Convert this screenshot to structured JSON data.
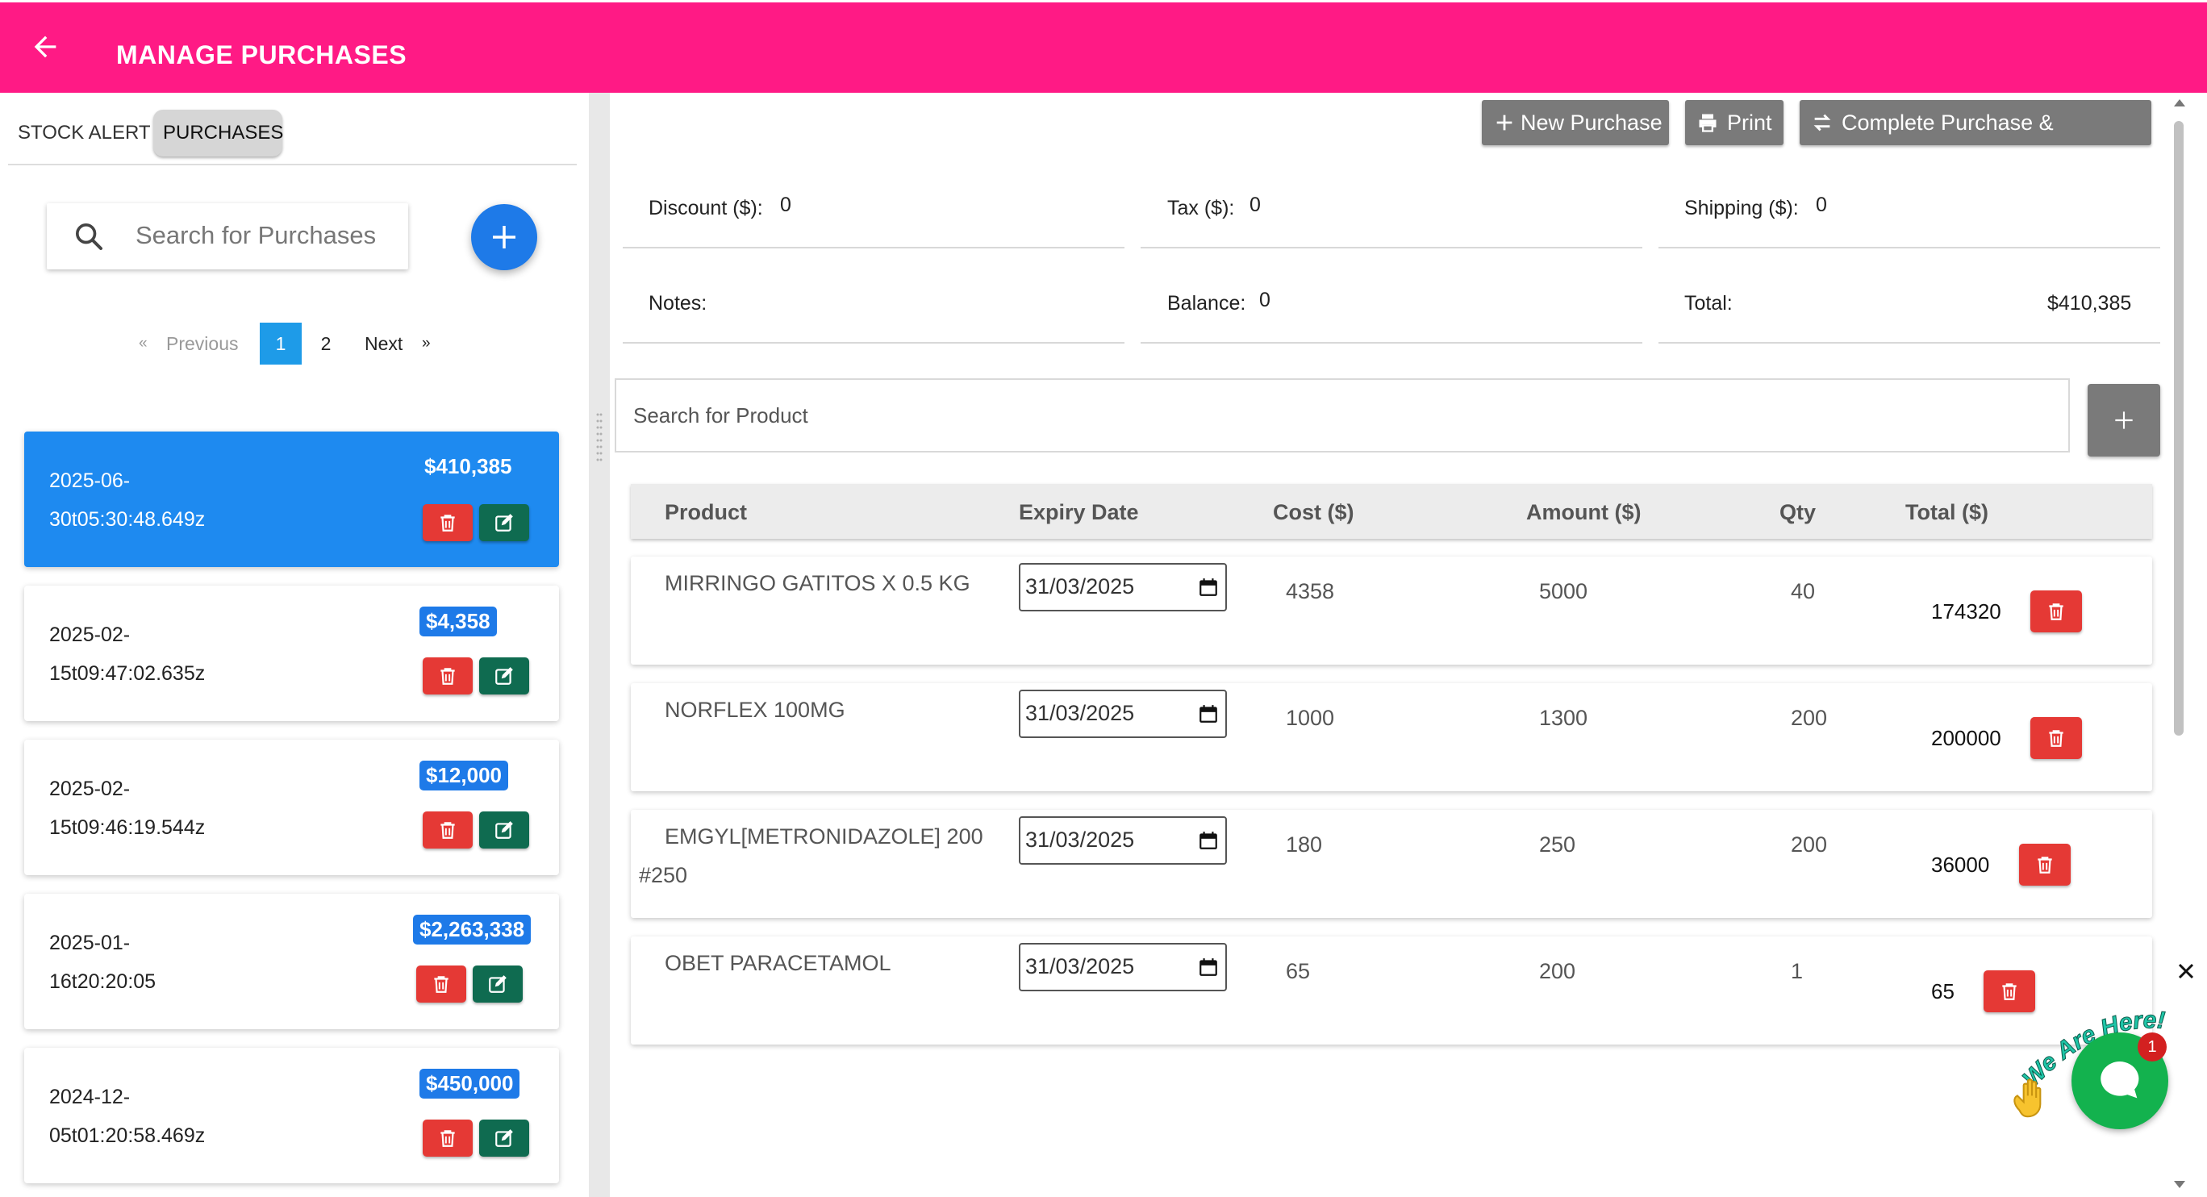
{
  "header": {
    "title": "MANAGE PURCHASES"
  },
  "tabs": [
    {
      "label": "STOCK ALERT"
    },
    {
      "label": "PURCHASES"
    }
  ],
  "search": {
    "placeholder": "Search for Purchases"
  },
  "pagination": {
    "previous": "Previous",
    "pages": [
      "1",
      "2"
    ],
    "current": "1",
    "next": "Next",
    "prev_arrow": "«",
    "next_arrow": "»"
  },
  "purchases": [
    {
      "date_line1": "2025-06-",
      "date_line2": "30t05:30:48.649z",
      "amount": "$410,385",
      "selected": true
    },
    {
      "date_line1": "2025-02-",
      "date_line2": "15t09:47:02.635z",
      "amount": "$4,358"
    },
    {
      "date_line1": "2025-02-",
      "date_line2": "15t09:46:19.544z",
      "amount": "$12,000"
    },
    {
      "date_line1": "2025-01-",
      "date_line2": "16t20:20:05",
      "amount": "$2,263,338"
    },
    {
      "date_line1": "2024-12-",
      "date_line2": "05t01:20:58.469z",
      "amount": "$450,000"
    }
  ],
  "toolbar": {
    "new_purchase": "New Purchase",
    "print": "Print",
    "complete": "Complete Purchase & Reconcile"
  },
  "summary": {
    "discount_label": "Discount ($):",
    "discount": "0",
    "tax_label": "Tax ($):",
    "tax": "0",
    "shipping_label": "Shipping ($):",
    "shipping": "0",
    "notes_label": "Notes:",
    "balance_label": "Balance:",
    "balance": "0",
    "total_label": "Total:",
    "total": "$410,385"
  },
  "product_search": {
    "placeholder": "Search for Product"
  },
  "table": {
    "headers": [
      "Product",
      "Expiry Date",
      "Cost ($)",
      "Amount ($)",
      "Qty",
      "Total ($)"
    ],
    "rows": [
      {
        "product": "MIRRINGO GATITOS X 0.5 KG",
        "product_line2": "",
        "expiry": "31/03/2025",
        "cost": "4358",
        "amount": "5000",
        "qty": "40",
        "total": "174320"
      },
      {
        "product": "NORFLEX 100MG",
        "product_line2": "",
        "expiry": "31/03/2025",
        "cost": "1000",
        "amount": "1300",
        "qty": "200",
        "total": "200000"
      },
      {
        "product": "EMGYL[METRONIDAZOLE] 200",
        "product_line2": "#250",
        "expiry": "31/03/2025",
        "cost": "180",
        "amount": "250",
        "qty": "200",
        "total": "36000"
      },
      {
        "product": "OBET PARACETAMOL",
        "product_line2": "",
        "expiry": "31/03/2025",
        "cost": "65",
        "amount": "200",
        "qty": "1",
        "total": "65"
      }
    ]
  },
  "chat": {
    "badge": "1",
    "tagline": "We Are Here!"
  },
  "colors": {
    "header": "#ff1a85",
    "primary": "#1e7ae8",
    "danger": "#e53935",
    "edit": "#0f6b50",
    "neutral_button": "#7a7a7a",
    "chat": "#13b24e"
  }
}
